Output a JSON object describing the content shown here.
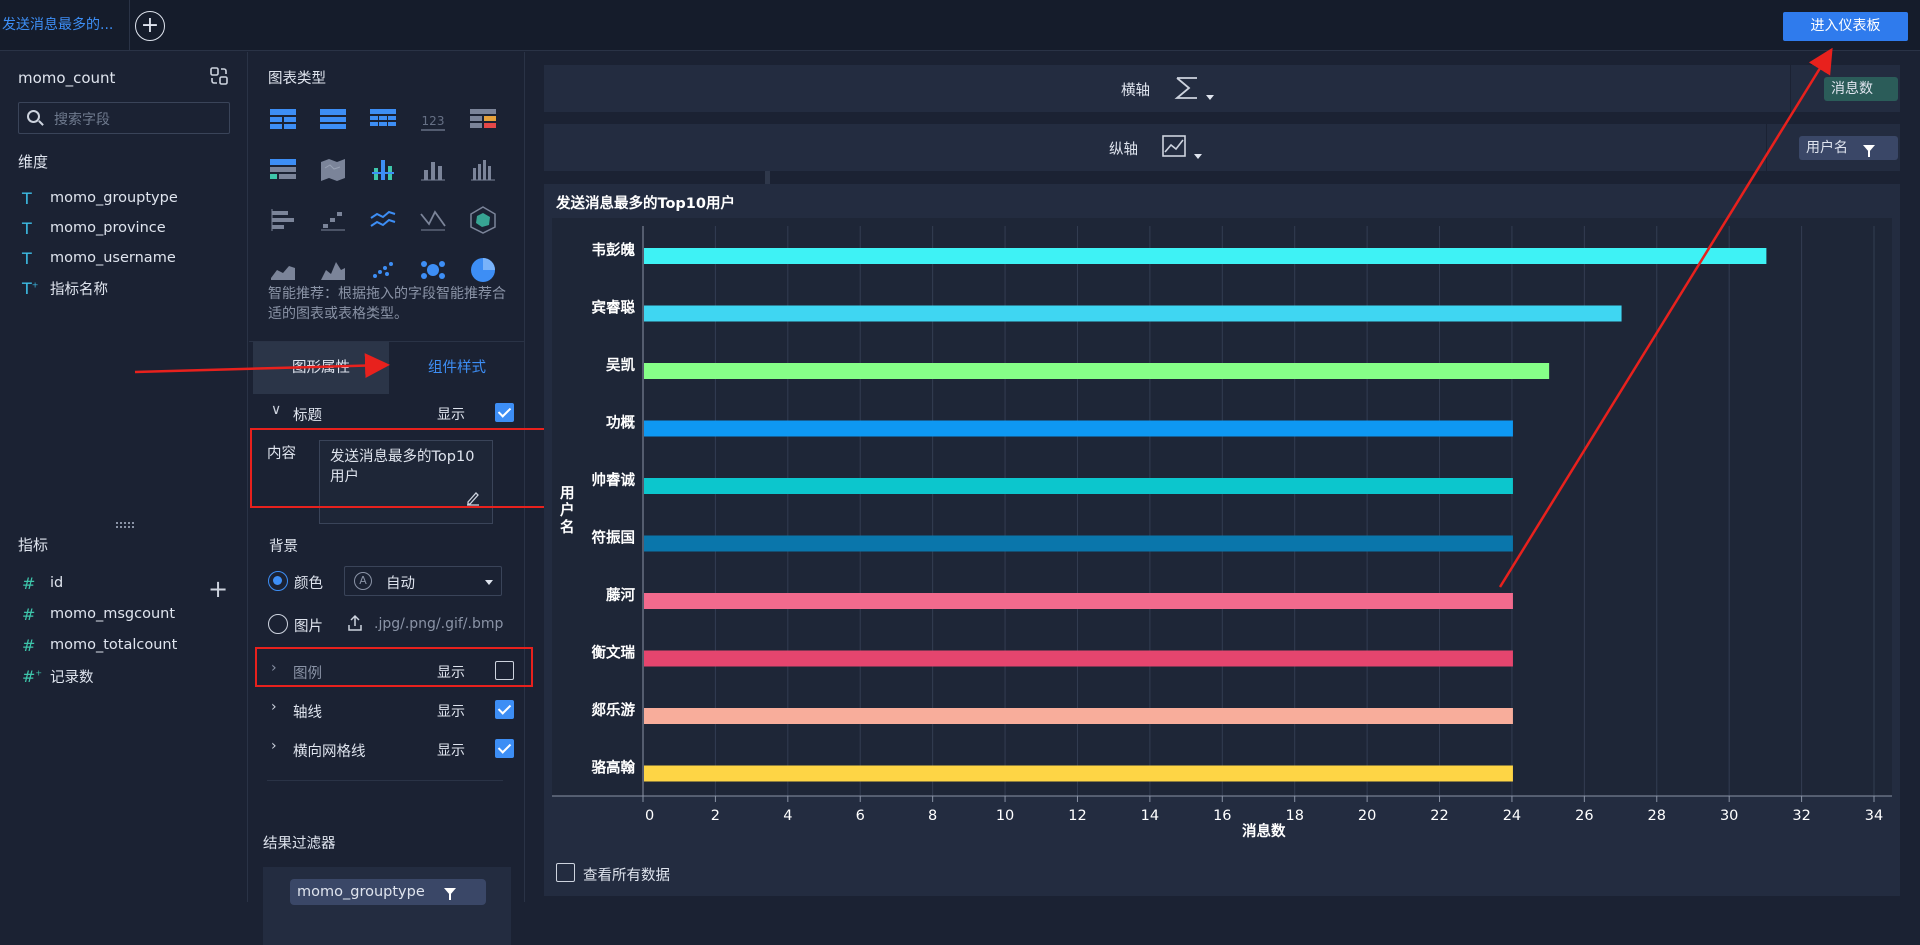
{
  "topbar": {
    "tab_label": "发送消息最多的...",
    "enter_button": "进入仪表板"
  },
  "fields": {
    "dataset": "momo_count",
    "search_placeholder": "搜索字段",
    "dimensions_title": "维度",
    "dimensions": [
      "momo_grouptype",
      "momo_province",
      "momo_username",
      "指标名称"
    ],
    "metrics_title": "指标",
    "metrics": [
      "id",
      "momo_msgcount",
      "momo_totalcount",
      "记录数"
    ]
  },
  "config": {
    "chart_type_title": "图表类型",
    "recommend_text": "智能推荐：根据拖入的字段智能推荐合适的图表或表格类型。",
    "tab_graph": "图形属性",
    "tab_style": "组件样式",
    "title_section": "标题",
    "show": "显示",
    "content_label": "内容",
    "content_value": "发送消息最多的Top10用户",
    "background_label": "背景",
    "color_label": "颜色",
    "color_value": "自动",
    "color_auto_glyph": "A",
    "image_label": "图片",
    "image_formats": ".jpg/.png/.gif/.bmp",
    "legend_label": "图例",
    "axis_line_label": "轴线",
    "hgrid_label": "横向网格线",
    "result_filter_title": "结果过滤器",
    "filter_field": "momo_grouptype"
  },
  "axes": {
    "x_label": "横轴",
    "x_field": "消息数",
    "y_label": "纵轴",
    "y_field": "用户名"
  },
  "footer": {
    "view_all": "查看所有数据"
  },
  "colors": {
    "accent": "#3d8ef5",
    "annotation_red": "#e8211d"
  },
  "chart_data": {
    "type": "bar",
    "orientation": "horizontal",
    "title": "发送消息最多的Top10用户",
    "xlabel": "消息数",
    "ylabel": "用户名",
    "categories": [
      "韦彭魄",
      "宾睿聪",
      "吴凯",
      "功概",
      "帅睿诚",
      "符振国",
      "藤河",
      "衡文瑞",
      "郯乐游",
      "骆高翰"
    ],
    "values": [
      31,
      27,
      25,
      24,
      24,
      24,
      24,
      24,
      24,
      24
    ],
    "colors": [
      "#3ef2f5",
      "#3fd6f2",
      "#86ff88",
      "#0e98f2",
      "#0cc6cd",
      "#0a76ab",
      "#f26a8d",
      "#e5456e",
      "#f8ad9b",
      "#fed545"
    ],
    "xlim": [
      0,
      34
    ],
    "xticks": [
      0,
      2,
      4,
      6,
      8,
      10,
      12,
      14,
      16,
      18,
      20,
      22,
      24,
      26,
      28,
      30,
      32,
      34
    ],
    "grid": true,
    "legend": "none"
  }
}
